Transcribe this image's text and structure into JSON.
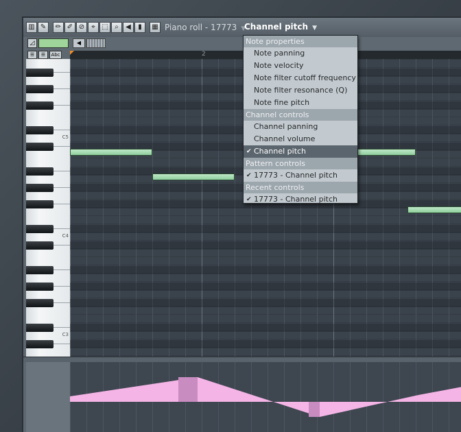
{
  "window": {
    "title": "Piano roll - 17773",
    "target_control": "Channel pitch"
  },
  "toolbar": {
    "tools": [
      {
        "name": "keyboard-icon",
        "glyph": "▥"
      },
      {
        "name": "wrench-icon",
        "glyph": "✎"
      },
      {
        "name": "pencil-icon",
        "glyph": "✏"
      },
      {
        "name": "brush-icon",
        "glyph": "✐"
      },
      {
        "name": "delete-icon",
        "glyph": "⊘"
      },
      {
        "name": "slice-icon",
        "glyph": "⌖"
      },
      {
        "name": "select-icon",
        "glyph": "⬚"
      },
      {
        "name": "zoom-icon",
        "glyph": "⌕"
      },
      {
        "name": "speaker-icon",
        "glyph": "◀"
      },
      {
        "name": "bars-icon",
        "glyph": "▮"
      },
      {
        "name": "grid-icon",
        "glyph": "▦"
      }
    ]
  },
  "ruler": {
    "bar_marks": [
      "2"
    ],
    "buttons": [
      "☰",
      "☰",
      "Abc"
    ]
  },
  "keyboard": {
    "octave_labels": [
      "C5",
      "C4",
      "C3"
    ]
  },
  "notes_colors": {
    "note": "#9fd8a9",
    "event": "#f4b4e6",
    "grid": "#3a424b"
  },
  "menu": {
    "sections": [
      {
        "header": "Note properties",
        "items": [
          {
            "label": "Note panning",
            "checked": false,
            "selected": false
          },
          {
            "label": "Note velocity",
            "checked": false,
            "selected": false
          },
          {
            "label": "Note filter cutoff frequency",
            "checked": false,
            "selected": false
          },
          {
            "label": "Note filter resonance (Q)",
            "checked": false,
            "selected": false
          },
          {
            "label": "Note fine pitch",
            "checked": false,
            "selected": false
          }
        ]
      },
      {
        "header": "Channel controls",
        "items": [
          {
            "label": "Channel panning",
            "checked": false,
            "selected": false
          },
          {
            "label": "Channel volume",
            "checked": false,
            "selected": false
          },
          {
            "label": "Channel pitch",
            "checked": true,
            "selected": true
          }
        ]
      },
      {
        "header": "Pattern controls",
        "items": [
          {
            "label": "17773 - Channel pitch",
            "checked": true,
            "selected": false
          }
        ]
      },
      {
        "header": "Recent controls",
        "items": [
          {
            "label": "17773 - Channel pitch",
            "checked": true,
            "selected": false
          }
        ]
      }
    ]
  }
}
